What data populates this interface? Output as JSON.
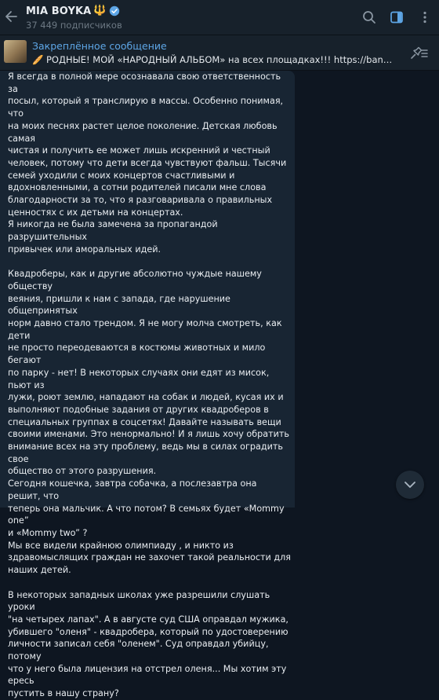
{
  "channel": {
    "name": "MIA BOYKA",
    "emoji": "🔱",
    "subscribers": "37 449 подписчиков"
  },
  "pinned": {
    "label": "Закреплённое сообщение",
    "emoji": "🥖",
    "text": "РОДНЫЕ! МОЙ «НАРОДНЫЙ АЛЬБОМ» на всех площадках!!!   https://band.link/n..."
  },
  "message": {
    "lines": [
      "Я всегда в полной мере осознавала свою ответственность за",
      "посыл, который я транслирую в массы. Особенно понимая, что",
      "на моих песнях растет целое поколение. Детская любовь самая",
      "чистая и получить ее может лишь искренний и честный",
      "человек, потому что дети всегда чувствуют фальш. Тысячи",
      "семей уходили с моих концертов счастливыми и",
      "вдохновленными, а сотни родителей писали мне слова",
      "благодарности за то, что я разговаривала о правильных",
      "ценностях с их детьми на концертах.",
      "Я никогда не была замечена за пропагандой разрушительных",
      "привычек или аморальных идей.",
      "",
      "Квадроберы, как и другие абсолютно чуждые  нашему обществу",
      "веяния, пришли к нам с запада, где нарушение общепринятых",
      "норм давно стало трендом. Я не могу молча смотреть, как дети",
      "не просто переодеваются в костюмы животных и мило бегают",
      "по парку - нет! В некоторых случаях они едят из мисок, пьют из",
      "лужи, роют землю, нападают на собак и людей, кусая их и",
      "выполняют подобные задания от других квадроберов в",
      "специальных группах в соцсетях! Давайте называть вещи",
      "своими именами. Это ненормально! И я лишь хочу обратить",
      "внимание всех на эту проблему, ведь мы в силах оградить свое",
      "общество от этого разрушения.",
      "Сегодня кошечка, завтра собачка, а послезавтра она решит, что",
      "теперь она мальчик. А что потом? В семьях будет «Mommy one”",
      "и «Mommy two” ?",
      "Мы все видели крайнюю олимпиаду , и никто из",
      "здравомыслящих граждан не захочет такой реальности для",
      "наших детей.",
      "",
      "В некоторых западных школах уже разрешили слушать уроки",
      "\"на четырех лапах\". А в августе суд США оправдал мужика,",
      "убившего \"оленя\" - квадробера, который по удостоверению",
      "личности записал себя \"оленем\". Суд оправдал убийцу, потому",
      "что у него была лицензия на отстрел оленя... Мы хотим эту ересь",
      "пустить в нашу страну?"
    ]
  },
  "icons": [
    "back-arrow-icon",
    "verified-icon",
    "search-icon",
    "sidebar-panel-icon",
    "more-vertical-icon",
    "pin-list-icon",
    "chevron-down-icon"
  ],
  "colors": {
    "background": "#0e1621",
    "header": "#17212b",
    "bubble": "#182533",
    "accent": "#5ea6e6"
  }
}
